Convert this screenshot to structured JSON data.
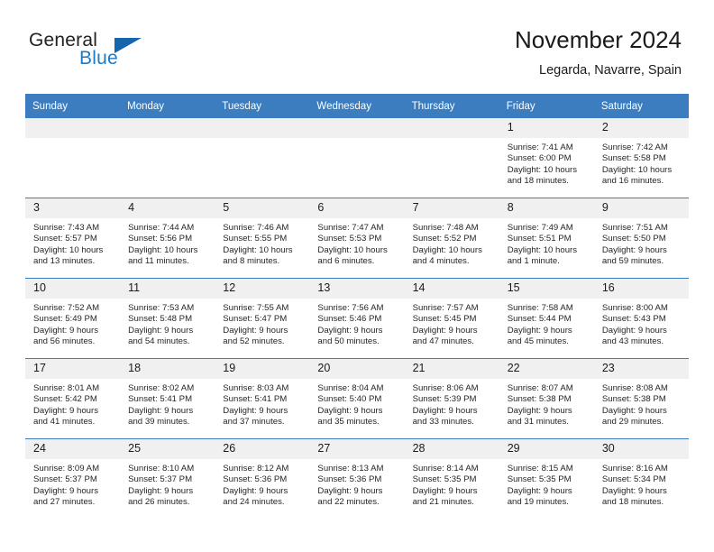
{
  "brand": {
    "name_part1": "General",
    "name_part2": "Blue",
    "triangle_color": "#1566ad",
    "blue_text_color": "#1f7ac4"
  },
  "header": {
    "title": "November 2024",
    "location": "Legarda, Navarre, Spain"
  },
  "theme": {
    "header_band": "#3b7dbf",
    "daynum_band": "#f0f0f0",
    "grid_line": "#3b7dbf"
  },
  "weekdays": [
    "Sunday",
    "Monday",
    "Tuesday",
    "Wednesday",
    "Thursday",
    "Friday",
    "Saturday"
  ],
  "weeks": [
    [
      {
        "day": "",
        "sunrise": "",
        "sunset": "",
        "daylight_line1": "",
        "daylight_line2": ""
      },
      {
        "day": "",
        "sunrise": "",
        "sunset": "",
        "daylight_line1": "",
        "daylight_line2": ""
      },
      {
        "day": "",
        "sunrise": "",
        "sunset": "",
        "daylight_line1": "",
        "daylight_line2": ""
      },
      {
        "day": "",
        "sunrise": "",
        "sunset": "",
        "daylight_line1": "",
        "daylight_line2": ""
      },
      {
        "day": "",
        "sunrise": "",
        "sunset": "",
        "daylight_line1": "",
        "daylight_line2": ""
      },
      {
        "day": "1",
        "sunrise": "Sunrise: 7:41 AM",
        "sunset": "Sunset: 6:00 PM",
        "daylight_line1": "Daylight: 10 hours",
        "daylight_line2": "and 18 minutes."
      },
      {
        "day": "2",
        "sunrise": "Sunrise: 7:42 AM",
        "sunset": "Sunset: 5:58 PM",
        "daylight_line1": "Daylight: 10 hours",
        "daylight_line2": "and 16 minutes."
      }
    ],
    [
      {
        "day": "3",
        "sunrise": "Sunrise: 7:43 AM",
        "sunset": "Sunset: 5:57 PM",
        "daylight_line1": "Daylight: 10 hours",
        "daylight_line2": "and 13 minutes."
      },
      {
        "day": "4",
        "sunrise": "Sunrise: 7:44 AM",
        "sunset": "Sunset: 5:56 PM",
        "daylight_line1": "Daylight: 10 hours",
        "daylight_line2": "and 11 minutes."
      },
      {
        "day": "5",
        "sunrise": "Sunrise: 7:46 AM",
        "sunset": "Sunset: 5:55 PM",
        "daylight_line1": "Daylight: 10 hours",
        "daylight_line2": "and 8 minutes."
      },
      {
        "day": "6",
        "sunrise": "Sunrise: 7:47 AM",
        "sunset": "Sunset: 5:53 PM",
        "daylight_line1": "Daylight: 10 hours",
        "daylight_line2": "and 6 minutes."
      },
      {
        "day": "7",
        "sunrise": "Sunrise: 7:48 AM",
        "sunset": "Sunset: 5:52 PM",
        "daylight_line1": "Daylight: 10 hours",
        "daylight_line2": "and 4 minutes."
      },
      {
        "day": "8",
        "sunrise": "Sunrise: 7:49 AM",
        "sunset": "Sunset: 5:51 PM",
        "daylight_line1": "Daylight: 10 hours",
        "daylight_line2": "and 1 minute."
      },
      {
        "day": "9",
        "sunrise": "Sunrise: 7:51 AM",
        "sunset": "Sunset: 5:50 PM",
        "daylight_line1": "Daylight: 9 hours",
        "daylight_line2": "and 59 minutes."
      }
    ],
    [
      {
        "day": "10",
        "sunrise": "Sunrise: 7:52 AM",
        "sunset": "Sunset: 5:49 PM",
        "daylight_line1": "Daylight: 9 hours",
        "daylight_line2": "and 56 minutes."
      },
      {
        "day": "11",
        "sunrise": "Sunrise: 7:53 AM",
        "sunset": "Sunset: 5:48 PM",
        "daylight_line1": "Daylight: 9 hours",
        "daylight_line2": "and 54 minutes."
      },
      {
        "day": "12",
        "sunrise": "Sunrise: 7:55 AM",
        "sunset": "Sunset: 5:47 PM",
        "daylight_line1": "Daylight: 9 hours",
        "daylight_line2": "and 52 minutes."
      },
      {
        "day": "13",
        "sunrise": "Sunrise: 7:56 AM",
        "sunset": "Sunset: 5:46 PM",
        "daylight_line1": "Daylight: 9 hours",
        "daylight_line2": "and 50 minutes."
      },
      {
        "day": "14",
        "sunrise": "Sunrise: 7:57 AM",
        "sunset": "Sunset: 5:45 PM",
        "daylight_line1": "Daylight: 9 hours",
        "daylight_line2": "and 47 minutes."
      },
      {
        "day": "15",
        "sunrise": "Sunrise: 7:58 AM",
        "sunset": "Sunset: 5:44 PM",
        "daylight_line1": "Daylight: 9 hours",
        "daylight_line2": "and 45 minutes."
      },
      {
        "day": "16",
        "sunrise": "Sunrise: 8:00 AM",
        "sunset": "Sunset: 5:43 PM",
        "daylight_line1": "Daylight: 9 hours",
        "daylight_line2": "and 43 minutes."
      }
    ],
    [
      {
        "day": "17",
        "sunrise": "Sunrise: 8:01 AM",
        "sunset": "Sunset: 5:42 PM",
        "daylight_line1": "Daylight: 9 hours",
        "daylight_line2": "and 41 minutes."
      },
      {
        "day": "18",
        "sunrise": "Sunrise: 8:02 AM",
        "sunset": "Sunset: 5:41 PM",
        "daylight_line1": "Daylight: 9 hours",
        "daylight_line2": "and 39 minutes."
      },
      {
        "day": "19",
        "sunrise": "Sunrise: 8:03 AM",
        "sunset": "Sunset: 5:41 PM",
        "daylight_line1": "Daylight: 9 hours",
        "daylight_line2": "and 37 minutes."
      },
      {
        "day": "20",
        "sunrise": "Sunrise: 8:04 AM",
        "sunset": "Sunset: 5:40 PM",
        "daylight_line1": "Daylight: 9 hours",
        "daylight_line2": "and 35 minutes."
      },
      {
        "day": "21",
        "sunrise": "Sunrise: 8:06 AM",
        "sunset": "Sunset: 5:39 PM",
        "daylight_line1": "Daylight: 9 hours",
        "daylight_line2": "and 33 minutes."
      },
      {
        "day": "22",
        "sunrise": "Sunrise: 8:07 AM",
        "sunset": "Sunset: 5:38 PM",
        "daylight_line1": "Daylight: 9 hours",
        "daylight_line2": "and 31 minutes."
      },
      {
        "day": "23",
        "sunrise": "Sunrise: 8:08 AM",
        "sunset": "Sunset: 5:38 PM",
        "daylight_line1": "Daylight: 9 hours",
        "daylight_line2": "and 29 minutes."
      }
    ],
    [
      {
        "day": "24",
        "sunrise": "Sunrise: 8:09 AM",
        "sunset": "Sunset: 5:37 PM",
        "daylight_line1": "Daylight: 9 hours",
        "daylight_line2": "and 27 minutes."
      },
      {
        "day": "25",
        "sunrise": "Sunrise: 8:10 AM",
        "sunset": "Sunset: 5:37 PM",
        "daylight_line1": "Daylight: 9 hours",
        "daylight_line2": "and 26 minutes."
      },
      {
        "day": "26",
        "sunrise": "Sunrise: 8:12 AM",
        "sunset": "Sunset: 5:36 PM",
        "daylight_line1": "Daylight: 9 hours",
        "daylight_line2": "and 24 minutes."
      },
      {
        "day": "27",
        "sunrise": "Sunrise: 8:13 AM",
        "sunset": "Sunset: 5:36 PM",
        "daylight_line1": "Daylight: 9 hours",
        "daylight_line2": "and 22 minutes."
      },
      {
        "day": "28",
        "sunrise": "Sunrise: 8:14 AM",
        "sunset": "Sunset: 5:35 PM",
        "daylight_line1": "Daylight: 9 hours",
        "daylight_line2": "and 21 minutes."
      },
      {
        "day": "29",
        "sunrise": "Sunrise: 8:15 AM",
        "sunset": "Sunset: 5:35 PM",
        "daylight_line1": "Daylight: 9 hours",
        "daylight_line2": "and 19 minutes."
      },
      {
        "day": "30",
        "sunrise": "Sunrise: 8:16 AM",
        "sunset": "Sunset: 5:34 PM",
        "daylight_line1": "Daylight: 9 hours",
        "daylight_line2": "and 18 minutes."
      }
    ]
  ]
}
